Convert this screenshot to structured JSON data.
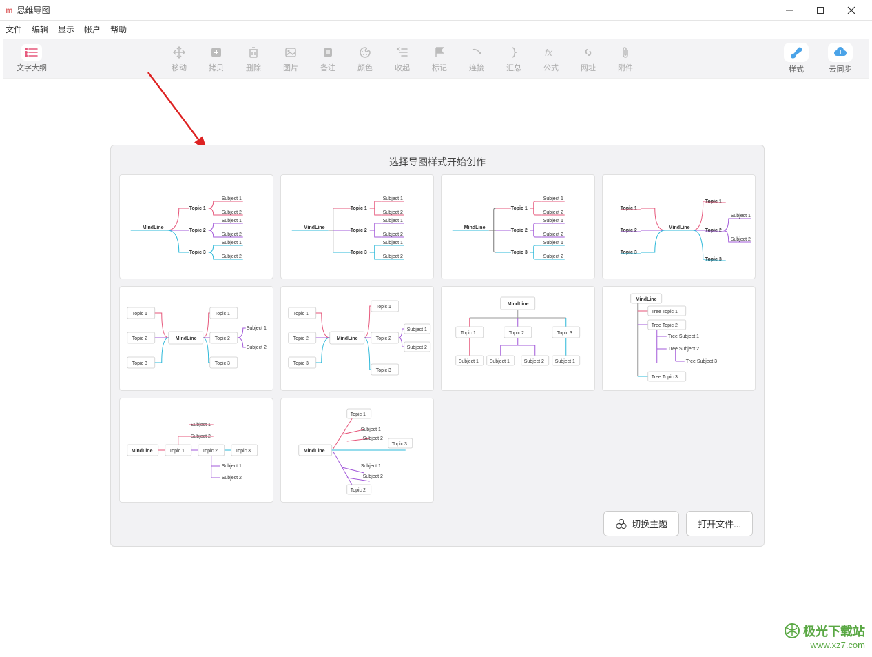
{
  "titlebar": {
    "app_icon": "m",
    "title": "思维导图"
  },
  "menubar": [
    "文件",
    "编辑",
    "显示",
    "帐户",
    "帮助"
  ],
  "toolbar": {
    "left": [
      {
        "id": "outline",
        "label": "文字大纲",
        "color": "#e6567a"
      }
    ],
    "mid": [
      {
        "id": "move",
        "label": "移动"
      },
      {
        "id": "copy",
        "label": "拷贝"
      },
      {
        "id": "delete",
        "label": "删除"
      },
      {
        "id": "image",
        "label": "图片"
      },
      {
        "id": "note",
        "label": "备注"
      },
      {
        "id": "color",
        "label": "颜色"
      },
      {
        "id": "collapse",
        "label": "收起"
      },
      {
        "id": "mark",
        "label": "标记"
      },
      {
        "id": "link",
        "label": "连接"
      },
      {
        "id": "summary",
        "label": "汇总"
      },
      {
        "id": "formula",
        "label": "公式"
      },
      {
        "id": "url",
        "label": "网址"
      },
      {
        "id": "attach",
        "label": "附件"
      }
    ],
    "right": [
      {
        "id": "style",
        "label": "样式"
      },
      {
        "id": "cloud",
        "label": "云同步"
      }
    ]
  },
  "dialog": {
    "title": "选择导图样式开始创作",
    "templates": {
      "root": "MindLine",
      "topic1": "Topic 1",
      "topic2": "Topic 2",
      "topic3": "Topic 3",
      "subject1": "Subject 1",
      "subject2": "Subject 2",
      "tree_topic1": "Tree Topic 1",
      "tree_topic2": "Tree Topic 2",
      "tree_topic3": "Tree Topic 3",
      "tree_subject1": "Tree Subject 1",
      "tree_subject2": "Tree Subject 2",
      "tree_subject3": "Tree Subject 3"
    },
    "buttons": {
      "theme": "切换主题",
      "open": "打开文件..."
    }
  },
  "watermark": {
    "brand": "极光下载站",
    "url": "www.xz7.com"
  },
  "colors": {
    "pink": "#e6567a",
    "purple": "#a259d9",
    "cyan": "#2bb8d9",
    "orange": "#e89a4f"
  }
}
